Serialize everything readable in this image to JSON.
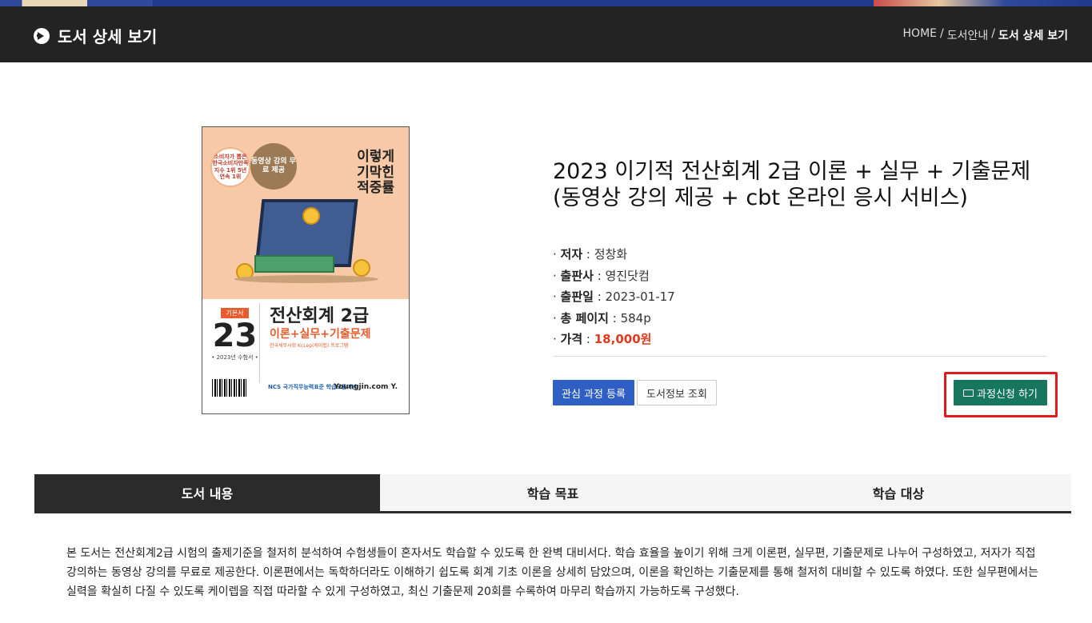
{
  "header": {
    "title": "도서 상세 보기",
    "breadcrumb": {
      "home": "HOME",
      "sep1": "/",
      "mid": "도서안내",
      "sep2": "/",
      "current": "도서 상세 보기"
    }
  },
  "cover": {
    "badge1": "소비자가 뽑은 한국소비자만족지수 1위 5년 연속 1위",
    "badge2": "동영상 강의 무료 제공",
    "slogan_line1": "이렇게",
    "slogan_line2": "기막힌",
    "slogan_line3": "적중률",
    "tag": "기본서",
    "year": "23",
    "edition": "• 2023년 수험서 •",
    "title": "전산회계 2급",
    "subtitle": "이론+실무+기출문제",
    "program": "한국세무사회 KcLep(케이랩) 프로그램",
    "ncs": "NCS 국가직무능력표준 학습모듈기반",
    "publisher": "Youngjin.com Y."
  },
  "book": {
    "title_line1": "2023 이기적 전산회계 2급 이론 + 실무 + 기출문제",
    "title_line2": "(동영상 강의 제공 + cbt 온라인 응시 서비스)",
    "author_label": "저자",
    "author": "정창화",
    "publisher_label": "출판사",
    "publisher": "영진닷컴",
    "date_label": "출판일",
    "date": "2023-01-17",
    "pages_label": "총 페이지",
    "pages": "584p",
    "price_label": "가격",
    "price": "18,000원"
  },
  "buttons": {
    "interest": "관심 과정 등록",
    "info": "도서정보 조회",
    "apply": "과정신청 하기"
  },
  "tabs": [
    {
      "label": "도서 내용"
    },
    {
      "label": "학습 목표"
    },
    {
      "label": "학습 대상"
    }
  ],
  "content": {
    "text": "본 도서는 전산회계2급 시험의 출제기준을 철저히 분석하여 수험생들이 혼자서도 학습할 수 있도록 한 완벽 대비서다. 학습 효율을 높이기 위해 크게 이론편, 실무편, 기출문제로 나누어 구성하였고, 저자가 직접 강의하는 동영상 강의를 무료로 제공한다. 이론편에서는 독학하더라도 이해하기 쉽도록 회계 기초 이론을 상세히 담았으며, 이론을 확인하는 기출문제를 통해 철저히 대비할 수 있도록 하였다. 또한 실무편에서는 실력을 확실히 다질 수 있도록 케이렙을 직접 따라할 수 있게 구성하였고, 최신 기출문제 20회를 수록하여 마무리 학습까지 가능하도록 구성했다."
  },
  "colors": {
    "header_bg": "#232323",
    "accent_blue": "#2f5fc4",
    "accent_green": "#17765e",
    "price_red": "#e5391b",
    "highlight_red": "#e01b1b"
  }
}
